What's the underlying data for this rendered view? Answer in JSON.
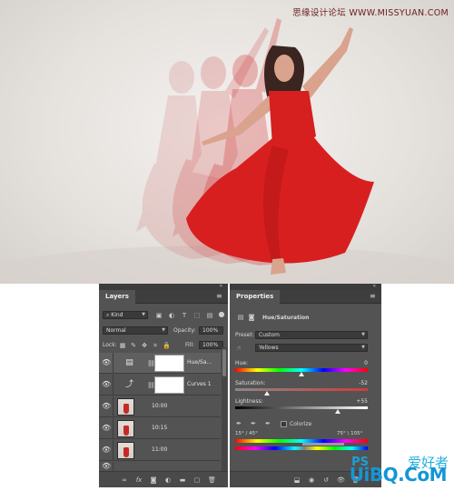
{
  "site_header": "思缘设计论坛 WWW.MISSYUAN.COM",
  "layers_panel": {
    "tab": "Layers",
    "filter_kind": "Kind",
    "blend_mode": "Normal",
    "opacity_label": "Opacity:",
    "opacity_value": "100%",
    "lock_label": "Lock:",
    "fill_label": "Fill:",
    "fill_value": "100%",
    "layers": [
      {
        "name": "Hue/Sa...",
        "type": "adjustment",
        "icon": "hue-saturation-icon",
        "selected": true
      },
      {
        "name": "Curves 1",
        "type": "adjustment",
        "icon": "curves-icon",
        "selected": false
      },
      {
        "name": "10:00",
        "type": "photo",
        "selected": false
      },
      {
        "name": "10:15",
        "type": "photo",
        "selected": false
      },
      {
        "name": "11:00",
        "type": "photo",
        "selected": false
      }
    ],
    "footer_icons": [
      "link-icon",
      "fx-icon",
      "add-mask-icon",
      "adjustment-icon",
      "group-icon",
      "new-layer-icon",
      "trash-icon"
    ]
  },
  "properties_panel": {
    "tab": "Properties",
    "title": "Hue/Saturation",
    "preset_label": "Preset:",
    "preset_value": "Custom",
    "channel_value": "Yellows",
    "hue_label": "Hue:",
    "hue_value": "0",
    "saturation_label": "Saturation:",
    "saturation_value": "-52",
    "lightness_label": "Lightness:",
    "lightness_value": "+55",
    "colorize_label": "Colorize",
    "range_left": "15° / 45°",
    "range_right": "75° \\ 105°",
    "values": {
      "hue": 0,
      "saturation": -52,
      "lightness": 55
    }
  },
  "watermark": {
    "ps": "PS",
    "cn": "爱好者",
    "brand": "UiBQ.CoM"
  },
  "colors": {
    "panel_bg": "#535353",
    "dress_red": "#d32525",
    "watermark_blue": "#1596d4"
  }
}
